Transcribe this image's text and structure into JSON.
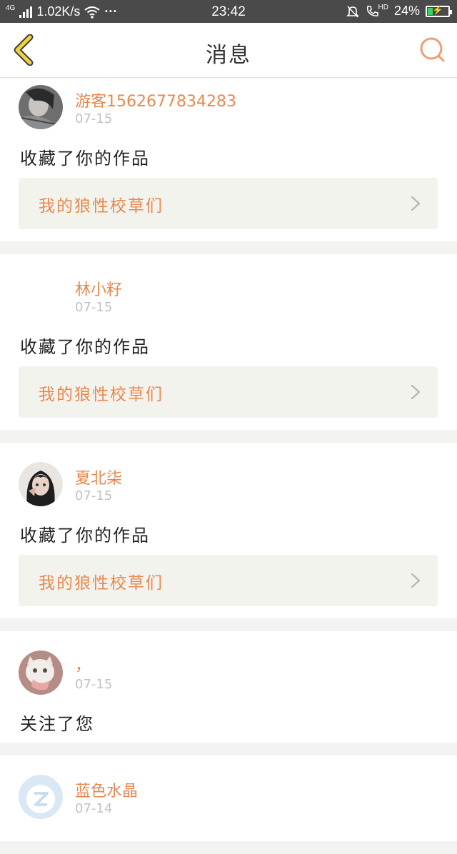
{
  "status_bar": {
    "network": "4G",
    "speed": "1.02K/s",
    "more": "···",
    "time": "23:42",
    "hd": "HD",
    "battery": "24%",
    "battery_level": 0.24,
    "icons": [
      "signal-icon",
      "wifi-icon",
      "mute-bell-icon",
      "call-icon",
      "battery-icon"
    ]
  },
  "header": {
    "title": "消息",
    "back_icon": "chevron-left-icon",
    "search_icon": "search-icon",
    "accent": "#e8884f"
  },
  "messages": [
    {
      "user": "游客1562677834283",
      "date": "07-15",
      "action": "收藏了你的作品",
      "work": "我的狼性校草们",
      "avatar": "photo"
    },
    {
      "user": "林小籽",
      "date": "07-15",
      "action": "收藏了你的作品",
      "work": "我的狼性校草们",
      "avatar": "none"
    },
    {
      "user": "夏北柒",
      "date": "07-15",
      "action": "收藏了你的作品",
      "work": "我的狼性校草们",
      "avatar": "photo"
    },
    {
      "user": "，",
      "date": "07-15",
      "action": "关注了您",
      "avatar": "photo"
    },
    {
      "user": "蓝色水晶",
      "date": "07-14",
      "avatar": "default"
    }
  ]
}
